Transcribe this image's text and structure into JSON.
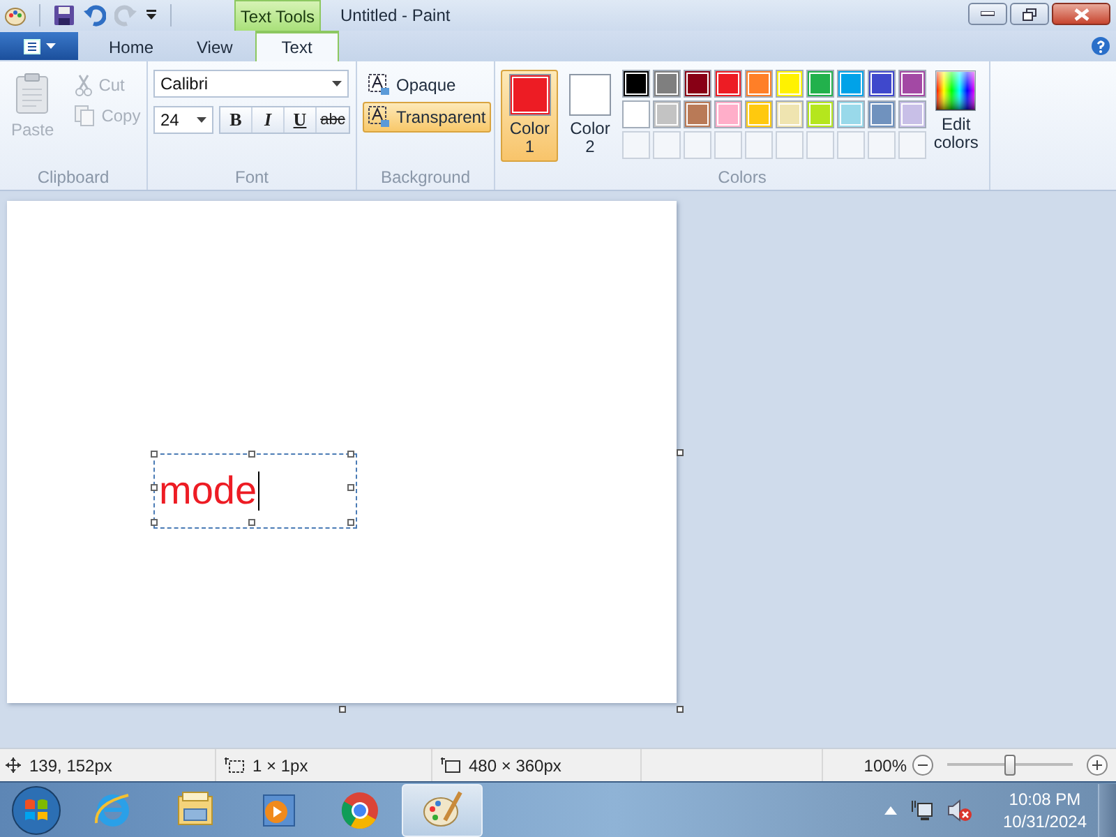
{
  "title_bar": {
    "contextual_tab": "Text Tools",
    "title": "Untitled - Paint"
  },
  "file_menu": {
    "open": false
  },
  "tabs": [
    {
      "label": "Home",
      "selected": false
    },
    {
      "label": "View",
      "selected": false
    },
    {
      "label": "Text",
      "selected": true
    }
  ],
  "clipboard": {
    "label": "Clipboard",
    "buttons": [
      {
        "kind": "paste",
        "label": "Paste",
        "disabled": true
      },
      {
        "kind": "cut",
        "label": "Cut",
        "disabled": true
      },
      {
        "kind": "copy",
        "label": "Copy",
        "disabled": true
      }
    ]
  },
  "font": {
    "label": "Font",
    "family": "Calibri",
    "size": "24",
    "styles": [
      {
        "kind": "bold",
        "label": "B",
        "selected": false
      },
      {
        "kind": "italic",
        "label": "I",
        "selected": false
      },
      {
        "kind": "underline",
        "label": "U",
        "selected": false
      },
      {
        "kind": "strikethrough",
        "label": "abc",
        "selected": false
      }
    ]
  },
  "background": {
    "label": "Background",
    "options": [
      {
        "label": "Opaque",
        "selected": false
      },
      {
        "label": "Transparent",
        "selected": true
      }
    ]
  },
  "colors": {
    "label": "Colors",
    "current": [
      {
        "label": "Color 1",
        "color": "#ed1c24",
        "selected": true
      },
      {
        "label": "Color 2",
        "color": "#ffffff",
        "selected": false
      }
    ],
    "palette": [
      {
        "color": "#000000"
      },
      {
        "color": "#7f7f7f"
      },
      {
        "color": "#880015"
      },
      {
        "color": "#ed1c24"
      },
      {
        "color": "#ff7f27"
      },
      {
        "color": "#fff200"
      },
      {
        "color": "#22b14c"
      },
      {
        "color": "#00a2e8"
      },
      {
        "color": "#3f48cc"
      },
      {
        "color": "#a349a4"
      },
      {
        "color": "#ffffff"
      },
      {
        "color": "#c3c3c3"
      },
      {
        "color": "#b97a57"
      },
      {
        "color": "#ffaec9"
      },
      {
        "color": "#ffc90e"
      },
      {
        "color": "#efe4b0"
      },
      {
        "color": "#b5e61d"
      },
      {
        "color": "#99d9ea"
      },
      {
        "color": "#7092be"
      },
      {
        "color": "#c8bfe7"
      }
    ],
    "edit_label": "Edit colors"
  },
  "canvas": {
    "text": "mode"
  },
  "status_bar": {
    "cursor": "139, 152px",
    "selection": "1 × 1px",
    "size": "480 × 360px",
    "zoom": "100%",
    "zoom_slider": {
      "level": 0.5
    }
  },
  "taskbar": {
    "apps": [
      {
        "kind": "ie",
        "selected": false
      },
      {
        "kind": "explorer",
        "selected": false
      },
      {
        "kind": "media",
        "selected": false
      },
      {
        "kind": "chrome",
        "selected": false
      },
      {
        "kind": "paint",
        "selected": true
      }
    ],
    "time": "10:08 PM",
    "date": "10/31/2024"
  }
}
